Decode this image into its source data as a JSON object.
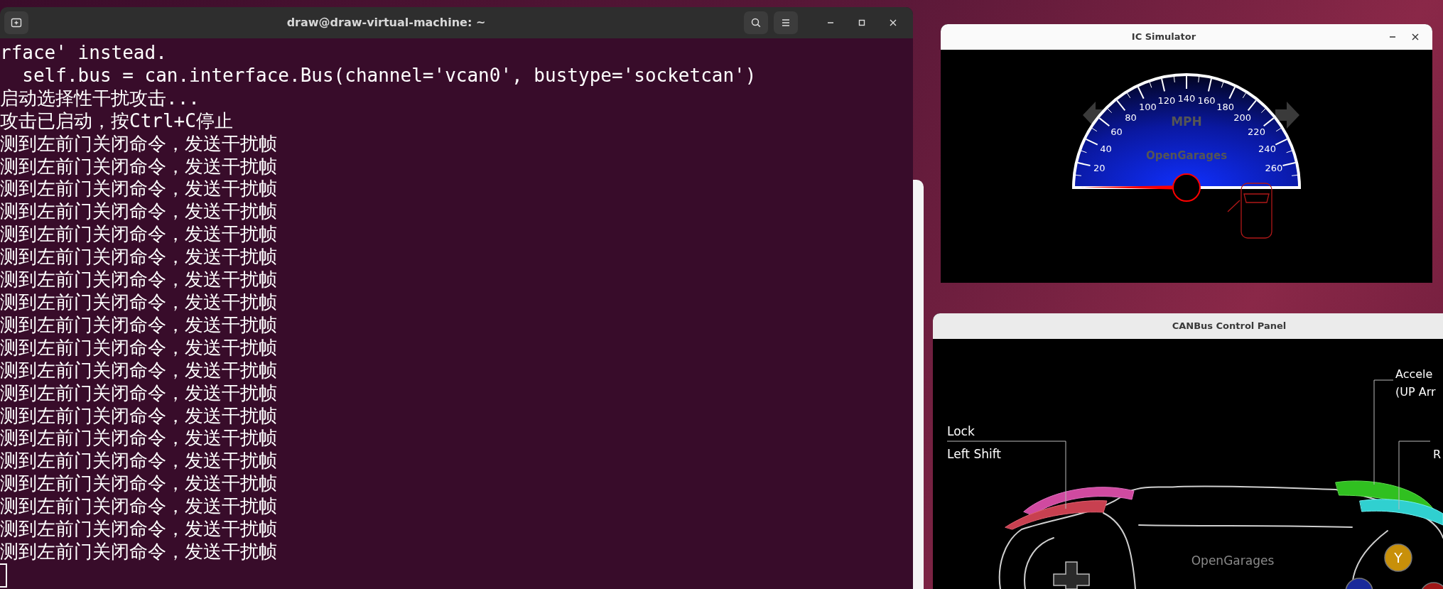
{
  "terminal": {
    "title": "draw@draw-virtual-machine: ~",
    "lines": [
      "rface' instead.",
      "  self.bus = can.interface.Bus(channel='vcan0', bustype='socketcan')",
      "启动选择性干扰攻击...",
      "攻击已启动，按Ctrl+C停止",
      "测到左前门关闭命令，发送干扰帧",
      "测到左前门关闭命令，发送干扰帧",
      "测到左前门关闭命令，发送干扰帧",
      "测到左前门关闭命令，发送干扰帧",
      "测到左前门关闭命令，发送干扰帧",
      "测到左前门关闭命令，发送干扰帧",
      "测到左前门关闭命令，发送干扰帧",
      "测到左前门关闭命令，发送干扰帧",
      "测到左前门关闭命令，发送干扰帧",
      "测到左前门关闭命令，发送干扰帧",
      "测到左前门关闭命令，发送干扰帧",
      "测到左前门关闭命令，发送干扰帧",
      "测到左前门关闭命令，发送干扰帧",
      "测到左前门关闭命令，发送干扰帧",
      "测到左前门关闭命令，发送干扰帧",
      "测到左前门关闭命令，发送干扰帧",
      "测到左前门关闭命令，发送干扰帧",
      "测到左前门关闭命令，发送干扰帧",
      "测到左前门关闭命令，发送干扰帧"
    ]
  },
  "ic_simulator": {
    "title": "IC Simulator",
    "turn_signals": [
      {
        "on": false
      },
      {
        "on": false
      }
    ],
    "gauge": {
      "unit": "MPH",
      "brand": "OpenGarages",
      "scale_labels": [
        "20",
        "40",
        "60",
        "80",
        "100",
        "120",
        "140",
        "160",
        "180",
        "200",
        "220",
        "240",
        "260"
      ]
    }
  },
  "canbus_panel": {
    "title": "CANBus Control Panel",
    "labels": [
      {
        "text": "Lock"
      },
      {
        "text": "Left Shift"
      },
      {
        "text": "Accele"
      },
      {
        "text": "(UP Arr"
      },
      {
        "text": "R"
      }
    ],
    "brand": "OpenGarages",
    "face_buttons": [
      "Y"
    ]
  }
}
